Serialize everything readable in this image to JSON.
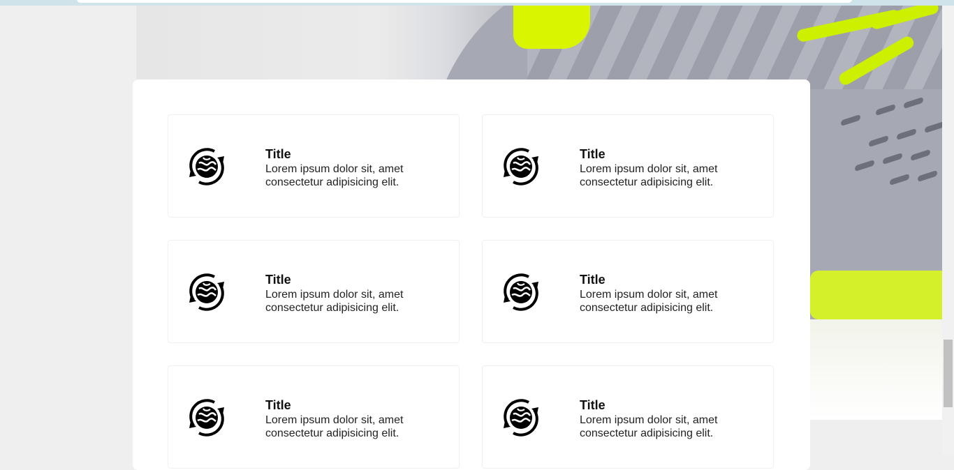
{
  "cards": [
    {
      "title": "Title",
      "desc": "Lorem ipsum dolor sit, amet consectetur adipisicing elit."
    },
    {
      "title": "Title",
      "desc": "Lorem ipsum dolor sit, amet consectetur adipisicing elit."
    },
    {
      "title": "Title",
      "desc": "Lorem ipsum dolor sit, amet consectetur adipisicing elit."
    },
    {
      "title": "Title",
      "desc": "Lorem ipsum dolor sit, amet consectetur adipisicing elit."
    },
    {
      "title": "Title",
      "desc": "Lorem ipsum dolor sit, amet consectetur adipisicing elit."
    },
    {
      "title": "Title",
      "desc": "Lorem ipsum dolor sit, amet consectetur adipisicing elit."
    }
  ],
  "icon_name": "recycle-globe-icon",
  "colors": {
    "accent_neon": "#d9f500",
    "page_bg": "#efefef",
    "panel_bg": "#ffffff"
  }
}
